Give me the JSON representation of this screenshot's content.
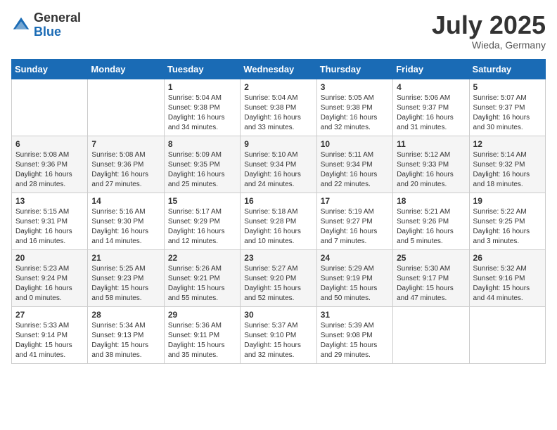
{
  "header": {
    "logo_general": "General",
    "logo_blue": "Blue",
    "month_title": "July 2025",
    "location": "Wieda, Germany"
  },
  "calendar": {
    "days_of_week": [
      "Sunday",
      "Monday",
      "Tuesday",
      "Wednesday",
      "Thursday",
      "Friday",
      "Saturday"
    ],
    "weeks": [
      [
        {
          "day": "",
          "info": ""
        },
        {
          "day": "",
          "info": ""
        },
        {
          "day": "1",
          "info": "Sunrise: 5:04 AM\nSunset: 9:38 PM\nDaylight: 16 hours\nand 34 minutes."
        },
        {
          "day": "2",
          "info": "Sunrise: 5:04 AM\nSunset: 9:38 PM\nDaylight: 16 hours\nand 33 minutes."
        },
        {
          "day": "3",
          "info": "Sunrise: 5:05 AM\nSunset: 9:38 PM\nDaylight: 16 hours\nand 32 minutes."
        },
        {
          "day": "4",
          "info": "Sunrise: 5:06 AM\nSunset: 9:37 PM\nDaylight: 16 hours\nand 31 minutes."
        },
        {
          "day": "5",
          "info": "Sunrise: 5:07 AM\nSunset: 9:37 PM\nDaylight: 16 hours\nand 30 minutes."
        }
      ],
      [
        {
          "day": "6",
          "info": "Sunrise: 5:08 AM\nSunset: 9:36 PM\nDaylight: 16 hours\nand 28 minutes."
        },
        {
          "day": "7",
          "info": "Sunrise: 5:08 AM\nSunset: 9:36 PM\nDaylight: 16 hours\nand 27 minutes."
        },
        {
          "day": "8",
          "info": "Sunrise: 5:09 AM\nSunset: 9:35 PM\nDaylight: 16 hours\nand 25 minutes."
        },
        {
          "day": "9",
          "info": "Sunrise: 5:10 AM\nSunset: 9:34 PM\nDaylight: 16 hours\nand 24 minutes."
        },
        {
          "day": "10",
          "info": "Sunrise: 5:11 AM\nSunset: 9:34 PM\nDaylight: 16 hours\nand 22 minutes."
        },
        {
          "day": "11",
          "info": "Sunrise: 5:12 AM\nSunset: 9:33 PM\nDaylight: 16 hours\nand 20 minutes."
        },
        {
          "day": "12",
          "info": "Sunrise: 5:14 AM\nSunset: 9:32 PM\nDaylight: 16 hours\nand 18 minutes."
        }
      ],
      [
        {
          "day": "13",
          "info": "Sunrise: 5:15 AM\nSunset: 9:31 PM\nDaylight: 16 hours\nand 16 minutes."
        },
        {
          "day": "14",
          "info": "Sunrise: 5:16 AM\nSunset: 9:30 PM\nDaylight: 16 hours\nand 14 minutes."
        },
        {
          "day": "15",
          "info": "Sunrise: 5:17 AM\nSunset: 9:29 PM\nDaylight: 16 hours\nand 12 minutes."
        },
        {
          "day": "16",
          "info": "Sunrise: 5:18 AM\nSunset: 9:28 PM\nDaylight: 16 hours\nand 10 minutes."
        },
        {
          "day": "17",
          "info": "Sunrise: 5:19 AM\nSunset: 9:27 PM\nDaylight: 16 hours\nand 7 minutes."
        },
        {
          "day": "18",
          "info": "Sunrise: 5:21 AM\nSunset: 9:26 PM\nDaylight: 16 hours\nand 5 minutes."
        },
        {
          "day": "19",
          "info": "Sunrise: 5:22 AM\nSunset: 9:25 PM\nDaylight: 16 hours\nand 3 minutes."
        }
      ],
      [
        {
          "day": "20",
          "info": "Sunrise: 5:23 AM\nSunset: 9:24 PM\nDaylight: 16 hours\nand 0 minutes."
        },
        {
          "day": "21",
          "info": "Sunrise: 5:25 AM\nSunset: 9:23 PM\nDaylight: 15 hours\nand 58 minutes."
        },
        {
          "day": "22",
          "info": "Sunrise: 5:26 AM\nSunset: 9:21 PM\nDaylight: 15 hours\nand 55 minutes."
        },
        {
          "day": "23",
          "info": "Sunrise: 5:27 AM\nSunset: 9:20 PM\nDaylight: 15 hours\nand 52 minutes."
        },
        {
          "day": "24",
          "info": "Sunrise: 5:29 AM\nSunset: 9:19 PM\nDaylight: 15 hours\nand 50 minutes."
        },
        {
          "day": "25",
          "info": "Sunrise: 5:30 AM\nSunset: 9:17 PM\nDaylight: 15 hours\nand 47 minutes."
        },
        {
          "day": "26",
          "info": "Sunrise: 5:32 AM\nSunset: 9:16 PM\nDaylight: 15 hours\nand 44 minutes."
        }
      ],
      [
        {
          "day": "27",
          "info": "Sunrise: 5:33 AM\nSunset: 9:14 PM\nDaylight: 15 hours\nand 41 minutes."
        },
        {
          "day": "28",
          "info": "Sunrise: 5:34 AM\nSunset: 9:13 PM\nDaylight: 15 hours\nand 38 minutes."
        },
        {
          "day": "29",
          "info": "Sunrise: 5:36 AM\nSunset: 9:11 PM\nDaylight: 15 hours\nand 35 minutes."
        },
        {
          "day": "30",
          "info": "Sunrise: 5:37 AM\nSunset: 9:10 PM\nDaylight: 15 hours\nand 32 minutes."
        },
        {
          "day": "31",
          "info": "Sunrise: 5:39 AM\nSunset: 9:08 PM\nDaylight: 15 hours\nand 29 minutes."
        },
        {
          "day": "",
          "info": ""
        },
        {
          "day": "",
          "info": ""
        }
      ]
    ]
  }
}
